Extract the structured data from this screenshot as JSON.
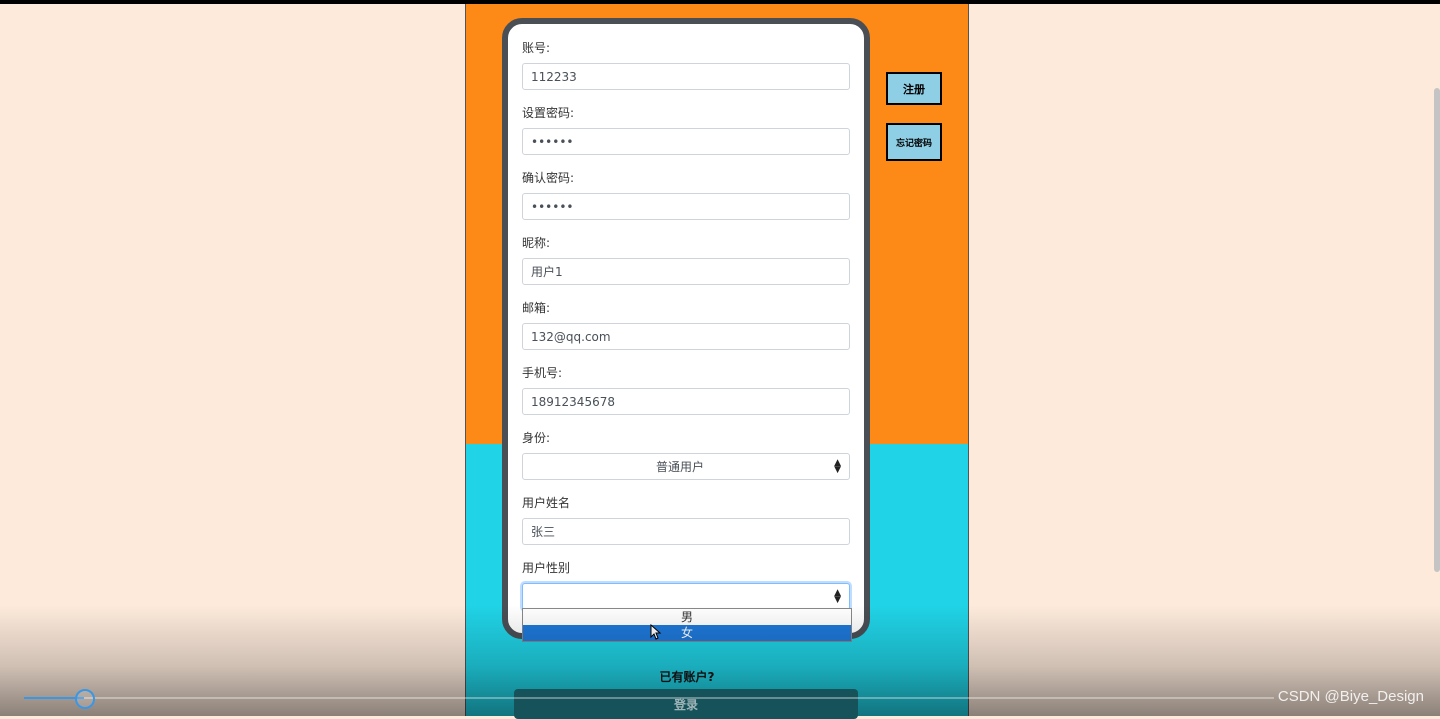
{
  "side_buttons": {
    "register": "注册",
    "forgot_password": "忘记密码"
  },
  "form": {
    "fields": [
      {
        "label": "账号:",
        "value": "112233",
        "type": "text"
      },
      {
        "label": "设置密码:",
        "value": "••••••",
        "type": "password"
      },
      {
        "label": "确认密码:",
        "value": "••••••",
        "type": "password"
      },
      {
        "label": "昵称:",
        "value": "用户1",
        "type": "text"
      },
      {
        "label": "邮箱:",
        "value": "132@qq.com",
        "type": "text"
      },
      {
        "label": "手机号:",
        "value": "18912345678",
        "type": "text"
      },
      {
        "label": "身份:",
        "value": "普通用户",
        "type": "select"
      },
      {
        "label": "用户姓名",
        "value": "张三",
        "type": "text"
      },
      {
        "label": "用户性别",
        "value": "",
        "type": "select"
      }
    ],
    "gender_options": [
      "男",
      "女"
    ],
    "gender_highlighted": "女"
  },
  "footer": {
    "have_account": "已有账户?",
    "login_label": "登录"
  },
  "watermark": "CSDN @Biye_Design",
  "video": {
    "progress": 0.05
  },
  "colors": {
    "background": "#fdeadb",
    "orange": "#fd8a17",
    "cyan": "#20d3e6",
    "card_border": "#4a4f55",
    "side_button": "#8ecfe6",
    "option_highlight": "#1e78d8"
  }
}
